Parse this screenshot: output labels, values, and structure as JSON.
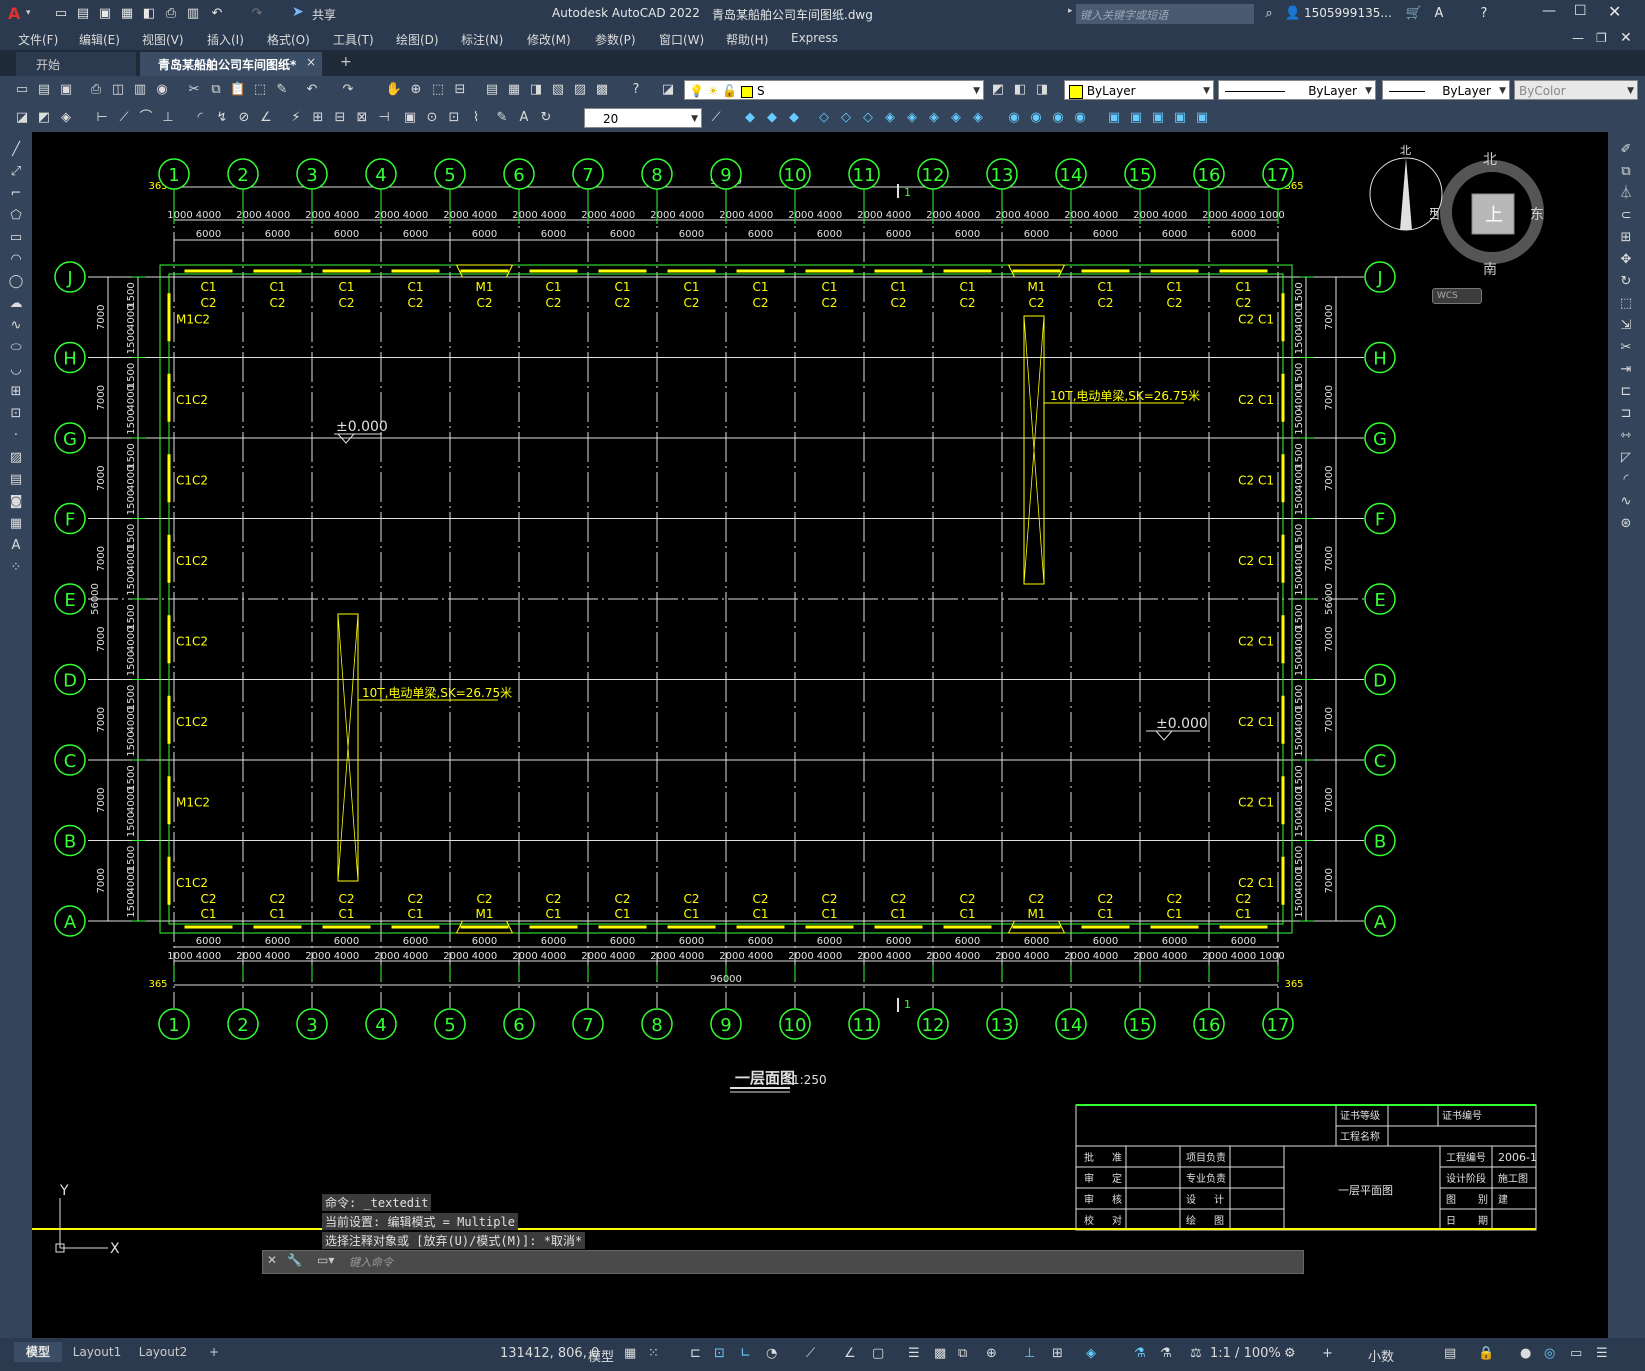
{
  "titlebar": {
    "app_icon": "A",
    "app_title": "Autodesk AutoCAD 2022",
    "file_name": "青岛某船舶公司车间图纸.dwg",
    "share_label": "共享",
    "search_placeholder": "键入关键字或短语",
    "user_name": "1505999135...",
    "window_controls": [
      "minimize-icon",
      "maximize-icon",
      "close-icon"
    ]
  },
  "menubar": {
    "items": [
      "文件(F)",
      "编辑(E)",
      "视图(V)",
      "插入(I)",
      "格式(O)",
      "工具(T)",
      "绘图(D)",
      "标注(N)",
      "修改(M)",
      "参数(P)",
      "窗口(W)",
      "帮助(H)",
      "Express"
    ]
  },
  "tabs": {
    "start": "开始",
    "drawing": "青岛某船舶公司车间图纸*",
    "close": "×",
    "new": "+"
  },
  "toolbar": {
    "layer_value": "S",
    "color_value": "ByLayer",
    "linetype_value": "ByLayer",
    "lineweight_value": "ByLayer",
    "plotstyle_value": "ByColor",
    "dim_scale_value": "20"
  },
  "viewcube": {
    "north": "北",
    "south": "南",
    "east": "东",
    "west": "西",
    "top": "上",
    "compass_n": "北",
    "wcs": "WCS"
  },
  "drawing": {
    "columns": [
      "1",
      "2",
      "3",
      "4",
      "5",
      "6",
      "7",
      "8",
      "9",
      "10",
      "11",
      "12",
      "13",
      "14",
      "15",
      "16",
      "17"
    ],
    "rows": [
      "J",
      "H",
      "G",
      "F",
      "E",
      "D",
      "C",
      "B",
      "A"
    ],
    "bay_dim": "6000",
    "total_dim": "96000",
    "overall_depth": "56000",
    "offset_dim": "365",
    "sub_dims": [
      "1000",
      "4000",
      "2000"
    ],
    "row_dims": [
      "7000",
      "4000",
      "1500"
    ],
    "crane_label": "10T,电动单梁,SK=26.75米",
    "elevation": "±0.000",
    "window_c1": "C1",
    "window_c2": "C2",
    "door_m1": "M1",
    "left_label_c": "C1C2",
    "left_label_m": "M1C2",
    "right_label": "C2 C1",
    "section_mark": "1",
    "plan_title": "一层面图",
    "plan_scale": "1:250"
  },
  "titleblock": {
    "cert_grade": "证书等级",
    "cert_no": "证书编号",
    "project_name": "工程名称",
    "r1": [
      "批",
      "准",
      "项目负责"
    ],
    "r2": [
      "审",
      "定",
      "专业负责"
    ],
    "r3": [
      "审",
      "核",
      "设",
      "计"
    ],
    "r4": [
      "校",
      "对",
      "绘",
      "图"
    ],
    "drawing_title": "一层平面图",
    "project_no_label": "工程编号",
    "project_no": "2006-1",
    "design_stage_label": "设计阶段",
    "design_stage": "施工图",
    "sheet_label": "图",
    "sheet_sep": "别",
    "sheet_val": "建",
    "date_label": "日",
    "date_sep": "期"
  },
  "command": {
    "line1": "命令: _textedit",
    "line2": "当前设置: 编辑模式 = Multiple",
    "line3": "选择注释对象或 [放弃(U)/模式(M)]: *取消*",
    "input_placeholder": "键入命令"
  },
  "ucs": {
    "x": "X",
    "y": "Y"
  },
  "layout_tabs": [
    "模型",
    "Layout1",
    "Layout2",
    "+"
  ],
  "status": {
    "coordinates": "131412, 806, 0",
    "space": "模型",
    "annotation_scale": "1:1 / 100%",
    "units": "小数"
  },
  "colors": {
    "cad_green": "#33ff33",
    "cad_yellow": "#ffff00",
    "cad_white": "#e0e0e0",
    "ui_dark": "#2b3a4e"
  }
}
